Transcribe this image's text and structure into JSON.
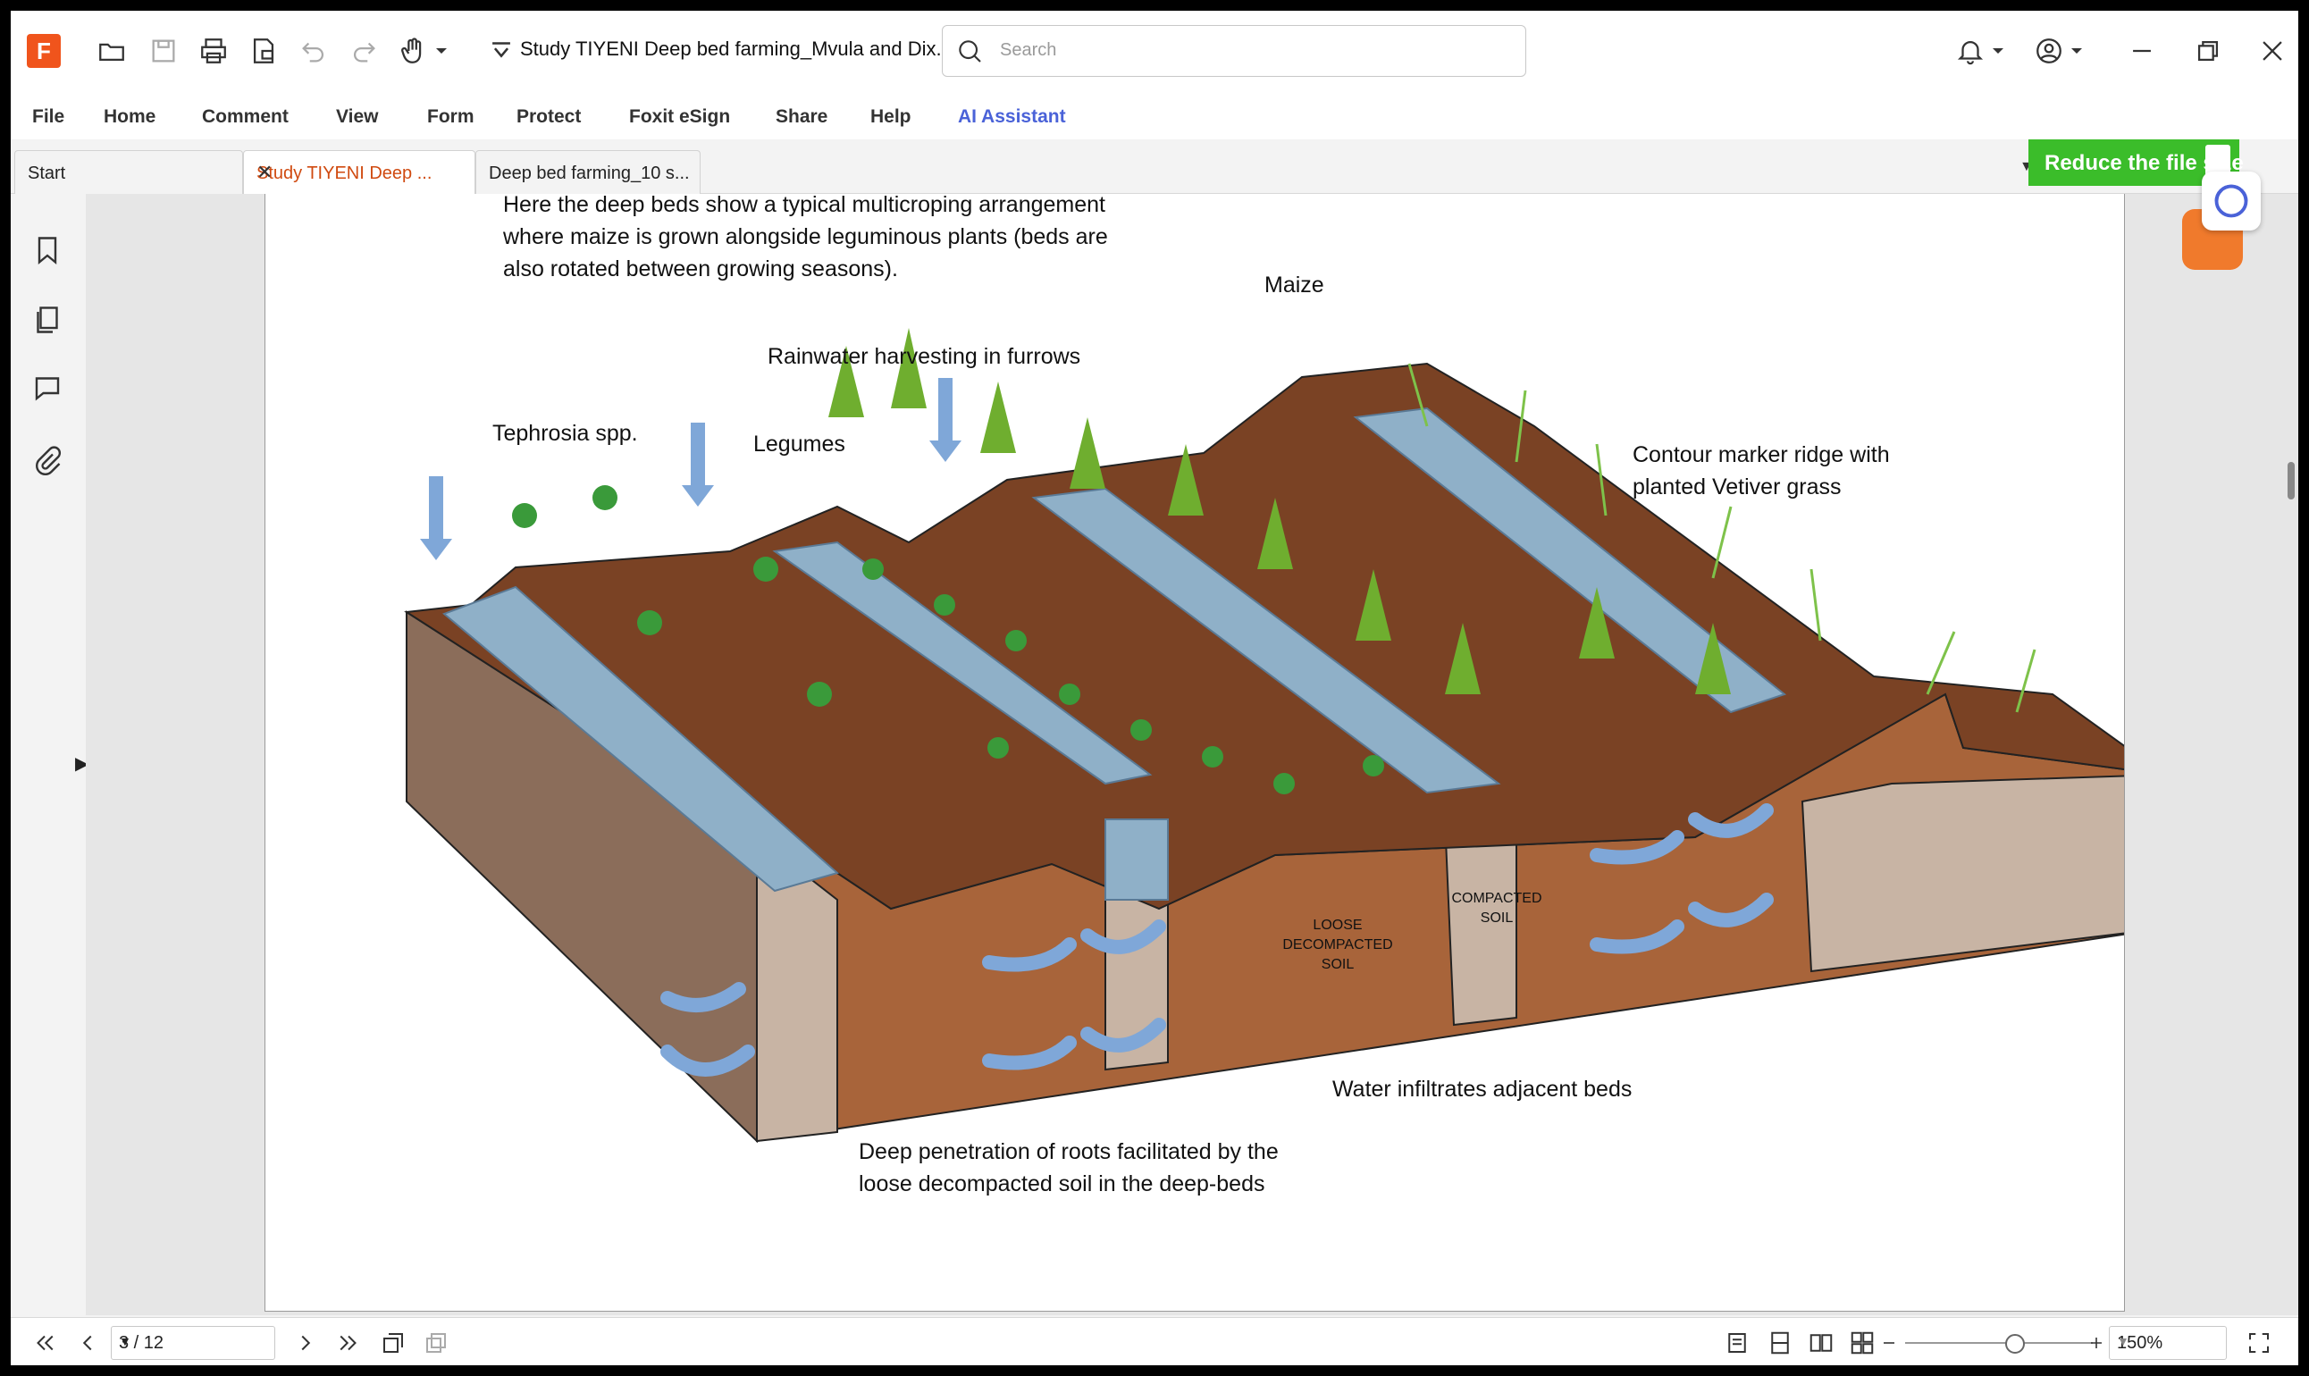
{
  "window": {
    "doc_title": "Study TIYENI Deep bed farming_Mvula and Dix...",
    "search_placeholder": "Search"
  },
  "menu": [
    "File",
    "Home",
    "Comment",
    "View",
    "Form",
    "Protect",
    "Foxit eSign",
    "Share",
    "Help",
    "AI Assistant"
  ],
  "tabs": [
    {
      "label": "Start"
    },
    {
      "label": "Study TIYENI Deep ..."
    },
    {
      "label": "Deep bed farming_10 s..."
    }
  ],
  "banner": {
    "label": "Reduce the file size",
    "color": "#3bbd2a"
  },
  "page": {
    "intro": [
      "Here the deep beds show a typical multicroping arrangement",
      "where maize is grown alongside leguminous plants (beds are",
      "also rotated between growing seasons)."
    ],
    "labels": {
      "maize": "Maize",
      "rainwater": "Rainwater harvesting in furrows",
      "tephrosia": "Tephrosia spp.",
      "legumes": "Legumes",
      "contour1": "Contour marker ridge with",
      "contour2": "planted Vetiver grass",
      "loose1": "LOOSE",
      "loose2": "DECOMPACTED",
      "loose3": "SOIL",
      "compacted1": "COMPACTED",
      "compacted2": "SOIL",
      "infiltrate": "Water infiltrates adjacent beds",
      "roots1": "Deep penetration of roots facilitated by the",
      "roots2": "loose decompacted soil in the deep-beds"
    }
  },
  "status": {
    "page_indicator": "3 / 12",
    "zoom": "150%"
  },
  "colors": {
    "accent": "#f0541c",
    "ai": "#4a62d8",
    "active_tab": "#d04a10"
  }
}
